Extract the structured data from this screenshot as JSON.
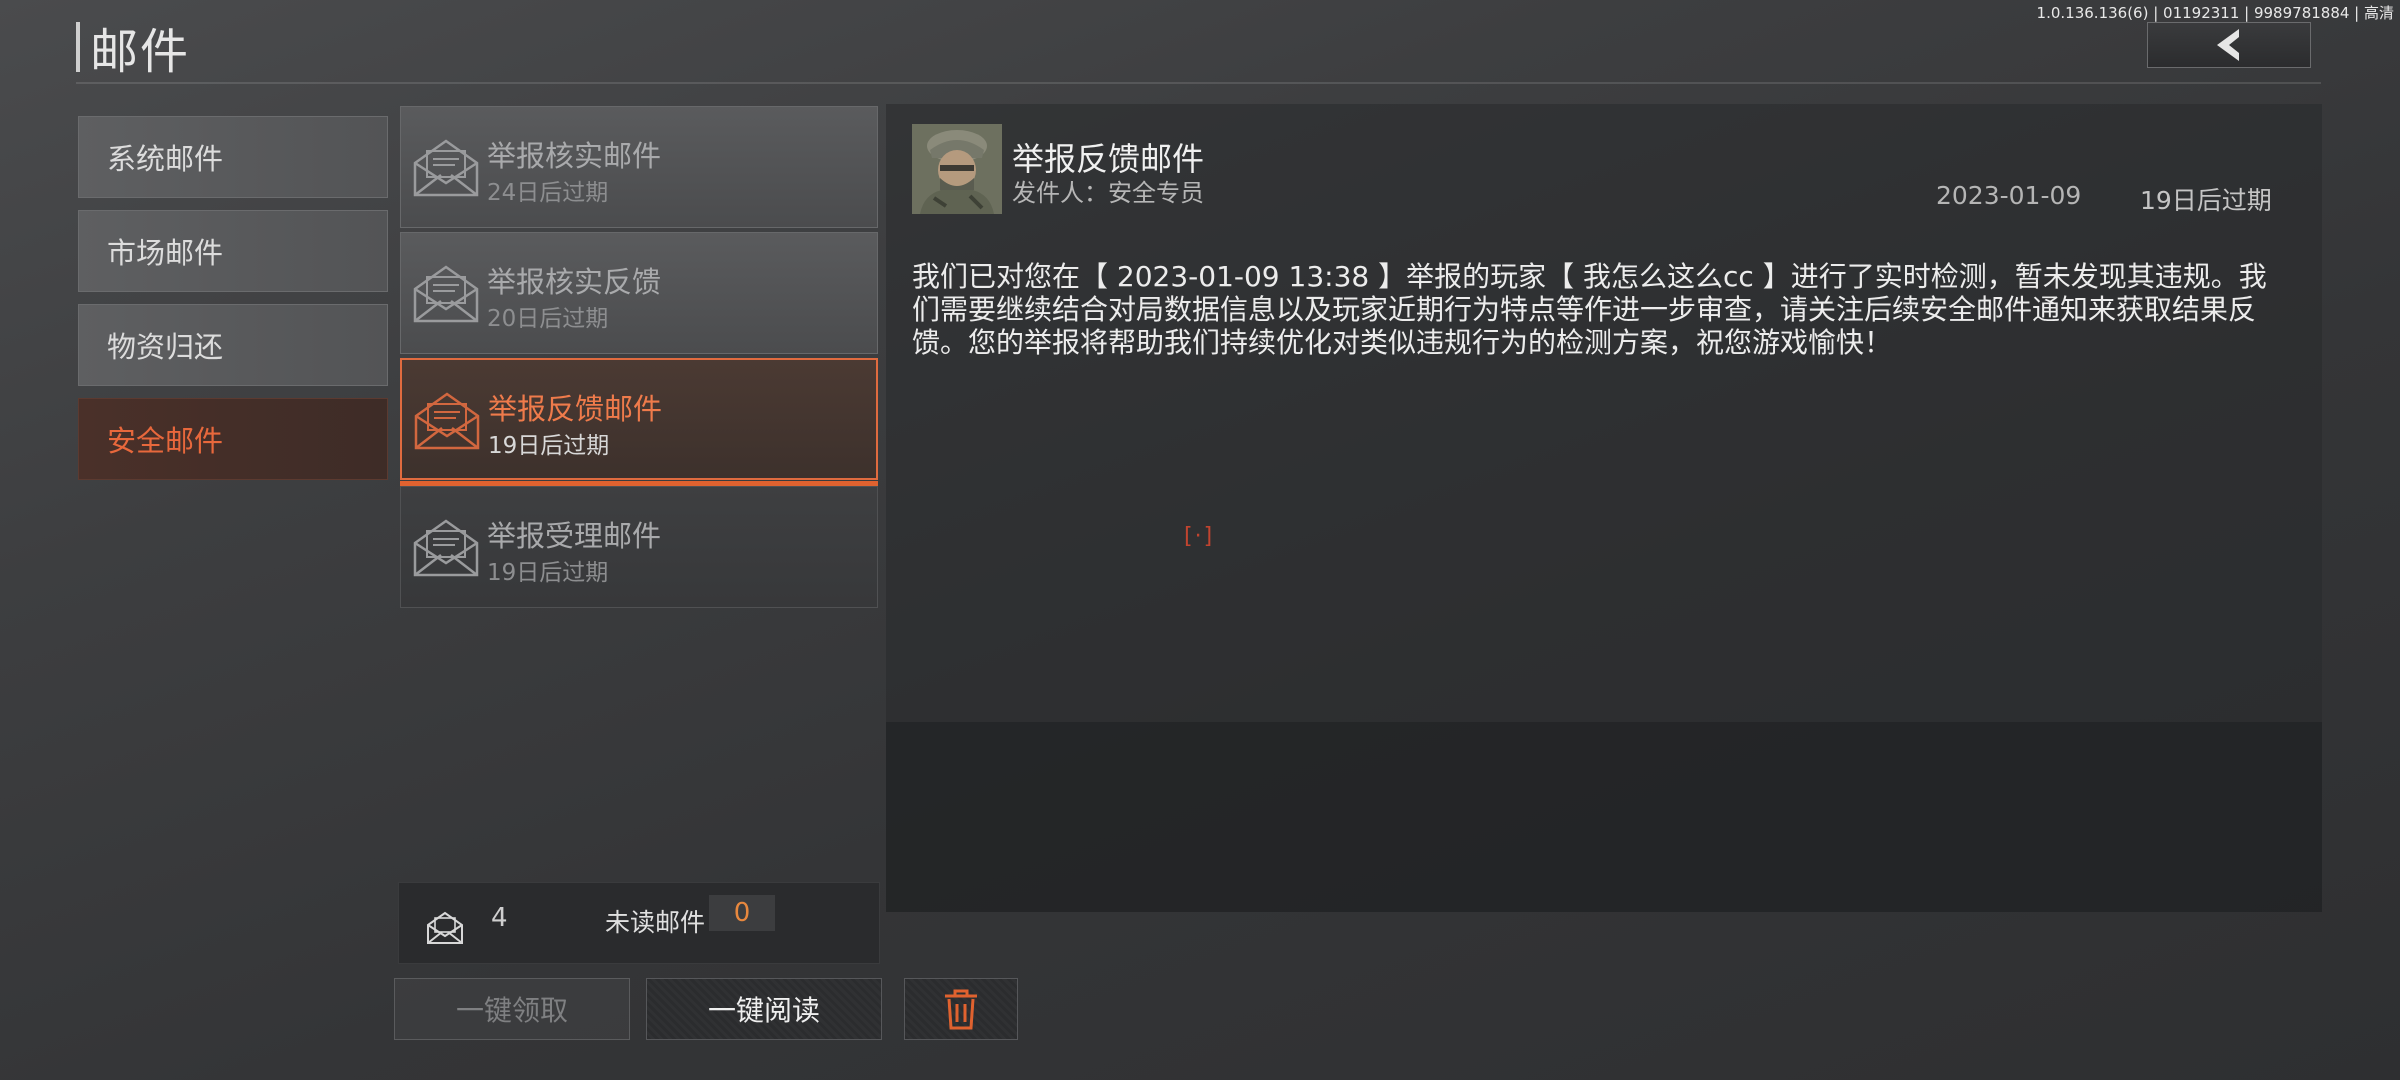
{
  "header": {
    "title": "邮件",
    "version_info": "1.0.136.136(6) | 01192311 | 9989781884 | 高清"
  },
  "categories": [
    {
      "label": "系统邮件",
      "active": false
    },
    {
      "label": "市场邮件",
      "active": false
    },
    {
      "label": "物资归还",
      "active": false
    },
    {
      "label": "安全邮件",
      "active": true
    }
  ],
  "mails": [
    {
      "title": "举报核实邮件",
      "expire": "24日后过期",
      "state": "read"
    },
    {
      "title": "举报核实反馈",
      "expire": "20日后过期",
      "state": "read"
    },
    {
      "title": "举报反馈邮件",
      "expire": "19日后过期",
      "state": "selected"
    },
    {
      "title": "举报受理邮件",
      "expire": "19日后过期",
      "state": "read"
    }
  ],
  "footer": {
    "mail_count": "4",
    "unread_label": "未读邮件",
    "unread_count": "0",
    "claim_all_label": "一键领取",
    "read_all_label": "一键阅读",
    "delete_icon": "trash-icon"
  },
  "detail": {
    "title": "举报反馈邮件",
    "sender": "发件人：安全专员",
    "date": "2023-01-09",
    "expire": "19日后过期",
    "body": "我们已对您在【 2023-01-09 13:38 】举报的玩家【 我怎么这么cc 】进行了实时检测，暂未发现其违规。我们需要继续结合对局数据信息以及玩家近期行为特点等作进一步审查，请关注后续安全邮件通知来获取结果反馈。您的举报将帮助我们持续优化对类似违规行为的检测方案，祝您游戏愉快！",
    "marker": "[·]"
  },
  "colors": {
    "accent": "#e0622f",
    "unread_count": "#e8883e",
    "marker": "#c2442f"
  }
}
